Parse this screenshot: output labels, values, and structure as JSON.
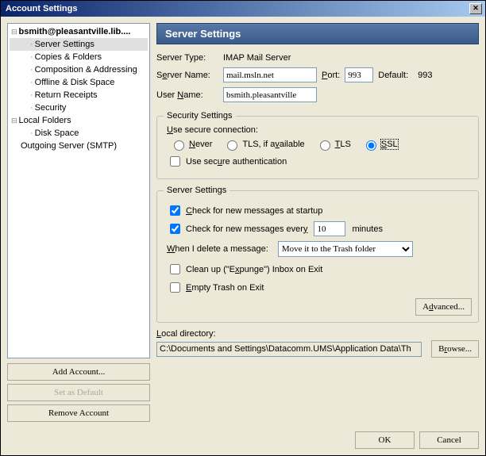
{
  "titlebar": {
    "title": "Account Settings"
  },
  "tree": {
    "account": "bsmith@pleasantville.lib....",
    "items": [
      "Server Settings",
      "Copies & Folders",
      "Composition & Addressing",
      "Offline & Disk Space",
      "Return Receipts",
      "Security"
    ],
    "local": "Local Folders",
    "localItems": [
      "Disk Space"
    ],
    "smtp": "Outgoing Server (SMTP)"
  },
  "leftButtons": {
    "add": "Add Account...",
    "setDefault": "Set as Default",
    "remove": "Remove Account"
  },
  "panel": {
    "header": "Server Settings",
    "serverTypeLabel": "Server Type:",
    "serverTypeValue": "IMAP Mail Server",
    "serverNameLabel_pre": "S",
    "serverNameLabel_u": "e",
    "serverNameLabel_post": "rver Name:",
    "serverNameValue": "mail.msln.net",
    "portLabel_pre": "",
    "portLabel_u": "P",
    "portLabel_post": "ort:",
    "portValue": "993",
    "defaultLabel": "Default:",
    "defaultValue": "993",
    "userNameLabel_pre": "User ",
    "userNameLabel_u": "N",
    "userNameLabel_post": "ame:",
    "userNameValue": "bsmith.pleasantville"
  },
  "security": {
    "legend": "Security Settings",
    "useSecureLabel_pre": "",
    "useSecureLabel_u": "U",
    "useSecureLabel_post": "se secure connection:",
    "radios": {
      "never_u": "N",
      "never_post": "ever",
      "tlsif_pre": "TLS, if a",
      "tlsif_u": "v",
      "tlsif_post": "ailable",
      "tls_u": "T",
      "tls_post": "LS",
      "ssl_u": "S",
      "ssl_post": "SL"
    },
    "useAuth_pre": "Use sec",
    "useAuth_u": "u",
    "useAuth_post": "re authentication"
  },
  "server": {
    "legend": "Server Settings",
    "chkStartup_u": "C",
    "chkStartup_post": "heck for new messages at startup",
    "chkEvery_pre": "Check for new messages ever",
    "chkEvery_u": "y",
    "chkEvery_post": "",
    "everyValue": "10",
    "everyMinutes": "minutes",
    "deleteLabel_u": "W",
    "deleteLabel_post": "hen I delete a message:",
    "deleteOption": "Move it to the Trash folder",
    "expunge_pre": "Clean up (\"E",
    "expunge_u": "x",
    "expunge_post": "punge\") Inbox on Exit",
    "emptyTrash_pre": "",
    "emptyTrash_u": "E",
    "emptyTrash_post": "mpty Trash on Exit",
    "advanced_pre": "A",
    "advanced_u": "d",
    "advanced_post": "vanced..."
  },
  "localdir": {
    "label_u": "L",
    "label_post": "ocal directory:",
    "value": "C:\\Documents and Settings\\Datacomm.UMS\\Application Data\\Th",
    "browse_pre": "B",
    "browse_u": "r",
    "browse_post": "owse..."
  },
  "bottom": {
    "ok": "OK",
    "cancel": "Cancel"
  }
}
